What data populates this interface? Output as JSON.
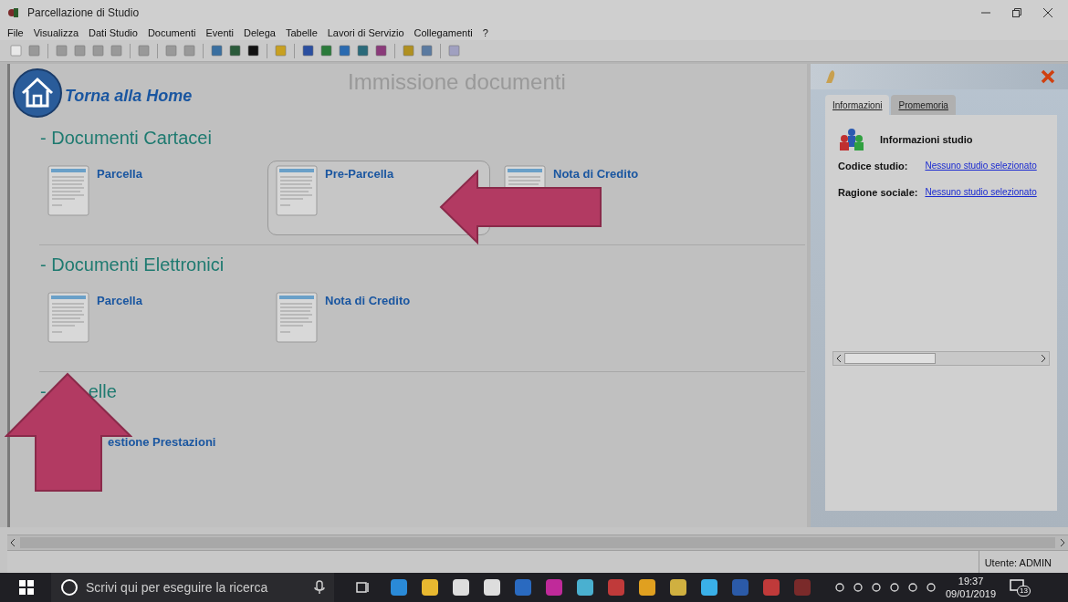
{
  "window": {
    "title": "Parcellazione di Studio"
  },
  "menu": [
    "File",
    "Visualizza",
    "Dati Studio",
    "Documenti",
    "Eventi",
    "Delega",
    "Tabelle",
    "Lavori di Servizio",
    "Collegamenti",
    "?"
  ],
  "page": {
    "title": "Immissione documenti",
    "home_link": "Torna alla Home",
    "sections": [
      {
        "heading": "- Documenti Cartacei",
        "kind": "documents",
        "items": [
          {
            "label": "Parcella",
            "selected": false
          },
          {
            "label": "Pre-Parcella",
            "selected": true
          },
          {
            "label": "Nota di Credito",
            "selected": false
          }
        ]
      },
      {
        "heading": "- Documenti Elettronici",
        "kind": "documents",
        "items": [
          {
            "label": "Parcella",
            "selected": false
          },
          {
            "label": "Nota di Credito",
            "selected": false
          }
        ]
      },
      {
        "heading_prefix": "-",
        "heading": "elle",
        "kind": "links",
        "items": [
          {
            "label": "estione Prestazioni",
            "selected": false
          }
        ]
      }
    ]
  },
  "side_panel": {
    "tabs": [
      {
        "label": "Informazioni",
        "selected": true
      },
      {
        "label": "Promemoria",
        "selected": false
      }
    ],
    "heading": "Informazioni studio",
    "fields": [
      {
        "label": "Codice studio:",
        "value": "Nessuno studio selezionato"
      },
      {
        "label": "Ragione sociale:",
        "value": "Nessuno studio selezionato"
      }
    ]
  },
  "status_bar": {
    "user": "Utente: ADMIN"
  },
  "taskbar": {
    "search_placeholder": "Scrivi qui per eseguire la ricerca",
    "time": "19:37",
    "date": "09/01/2019",
    "notifications": "13"
  }
}
